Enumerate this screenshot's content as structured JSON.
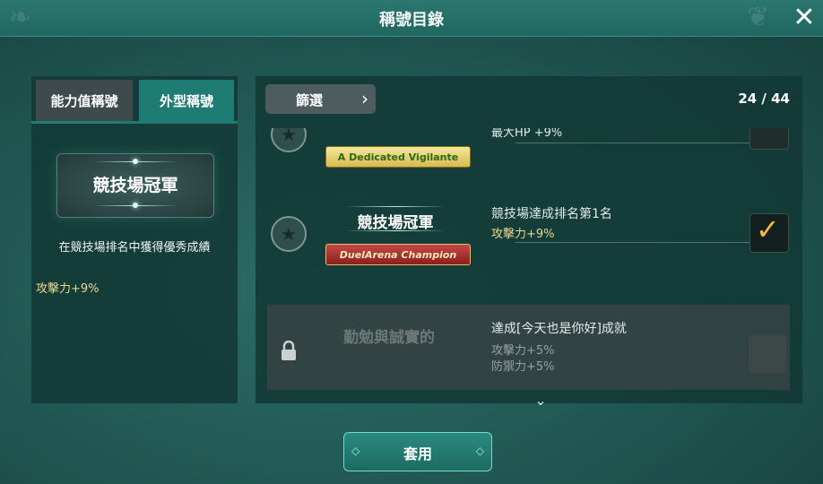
{
  "header": {
    "title": "稱號目錄",
    "close_icon": "close-icon"
  },
  "tabs": [
    {
      "label": "能力值稱號",
      "active": false
    },
    {
      "label": "外型稱號",
      "active": true
    }
  ],
  "preview": {
    "name": "競技場冠軍",
    "description": "在競技場排名中獲得優秀成績",
    "stat": "攻擊力+9%"
  },
  "list_header": {
    "filter_label": "篩選",
    "count": "24 / 44"
  },
  "titles": [
    {
      "banner_text": "A Dedicated Vigilante",
      "condition": "",
      "stat": "最大HP +9%",
      "checked": false
    },
    {
      "name": "競技場冠軍",
      "banner_text": "DuelArena Champion",
      "condition": "競技場達成排名第1名",
      "stat": "攻擊力+9%",
      "checked": true
    },
    {
      "name": "勤勉與誠實的",
      "condition": "達成[今天也是你好]成就",
      "stats": [
        "攻擊力+5%",
        "防禦力+5%"
      ],
      "locked": true
    }
  ],
  "footer": {
    "apply_label": "套用"
  },
  "colors": {
    "accent": "#1f7c74",
    "stat_gold": "#e8d890",
    "check": "#f0c040"
  }
}
